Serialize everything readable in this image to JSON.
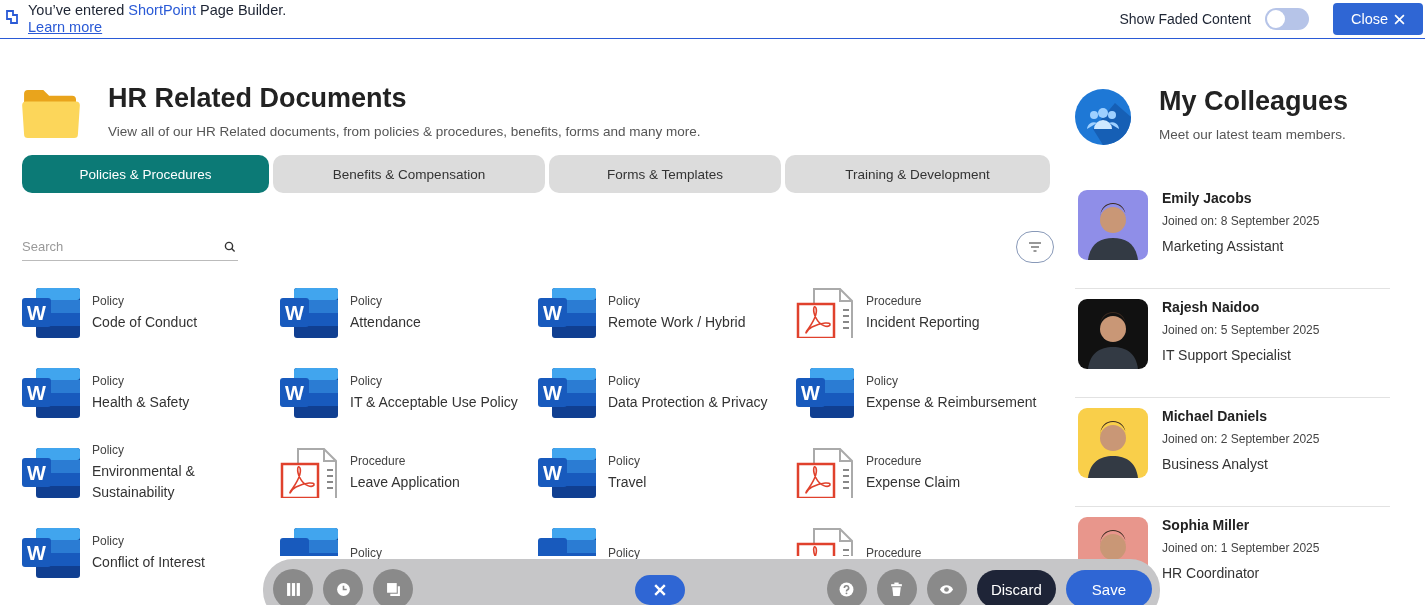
{
  "banner": {
    "text_before": "You’ve entered",
    "brand": "ShortPoint",
    "text_after": "Page Builder.",
    "link": "Learn more",
    "toggle": {
      "label": "Show Faded Content",
      "on": false
    },
    "close_button": "Close"
  },
  "documents": {
    "title": "HR Related Documents",
    "subtitle": "View all of our HR Related documents, from policies & procedures, benefits, forms and many more.",
    "tabs": [
      {
        "label": "Policies & Procedures",
        "selected": true
      },
      {
        "label": "Benefits & Compensation",
        "selected": false
      },
      {
        "label": "Forms & Templates",
        "selected": false
      },
      {
        "label": "Training & Development",
        "selected": false
      }
    ],
    "search": {
      "placeholder": "Search"
    },
    "items": [
      {
        "kind": "word",
        "badge": "W",
        "category": "Policy",
        "title": "Code of Conduct"
      },
      {
        "kind": "word",
        "badge": "W",
        "category": "Policy",
        "title": "Attendance"
      },
      {
        "kind": "word",
        "badge": "W",
        "category": "Policy",
        "title": "Remote Work / Hybrid"
      },
      {
        "kind": "pdf",
        "category": "Procedure",
        "title": "Incident Reporting"
      },
      {
        "kind": "word",
        "badge": "W",
        "category": "Policy",
        "title": "Health & Safety"
      },
      {
        "kind": "word",
        "badge": "W",
        "category": "Policy",
        "title": "IT & Acceptable Use Policy"
      },
      {
        "kind": "word",
        "badge": "W",
        "category": "Policy",
        "title": "Data Protection & Privacy"
      },
      {
        "kind": "word",
        "badge": "W",
        "category": "Policy",
        "title": "Expense & Reimbursement"
      },
      {
        "kind": "word",
        "badge": "W",
        "category": "Policy",
        "title": "Environmental & Sustainability"
      },
      {
        "kind": "pdf",
        "category": "Procedure",
        "title": "Leave Application"
      },
      {
        "kind": "word",
        "badge": "W",
        "category": "Policy",
        "title": "Travel"
      },
      {
        "kind": "pdf",
        "category": "Procedure",
        "title": "Expense Claim"
      },
      {
        "kind": "word",
        "badge": "W",
        "category": "Policy",
        "title": "Conflict of Interest"
      },
      {
        "kind": "word",
        "category": "Policy"
      },
      {
        "kind": "word",
        "category": "Policy"
      },
      {
        "kind": "pdf",
        "category": "Procedure"
      }
    ]
  },
  "colleagues": {
    "title": "My Colleagues",
    "subtitle": "Meet our latest team members.",
    "people": [
      {
        "name": "Emily Jacobs",
        "joined": "Joined on: 8 September 2025",
        "role": "Marketing Assistant"
      },
      {
        "name": "Rajesh Naidoo",
        "joined": "Joined on: 5 September 2025",
        "role": "IT Support Specialist"
      },
      {
        "name": "Michael Daniels",
        "joined": "Joined on: 2 September 2025",
        "role": "Business Analyst"
      },
      {
        "name": "Sophia Miller",
        "joined": "Joined on: 1 September 2025",
        "role": "HR Coordinator"
      }
    ]
  },
  "toolbar": {
    "discard": "Discard",
    "save": "Save"
  }
}
